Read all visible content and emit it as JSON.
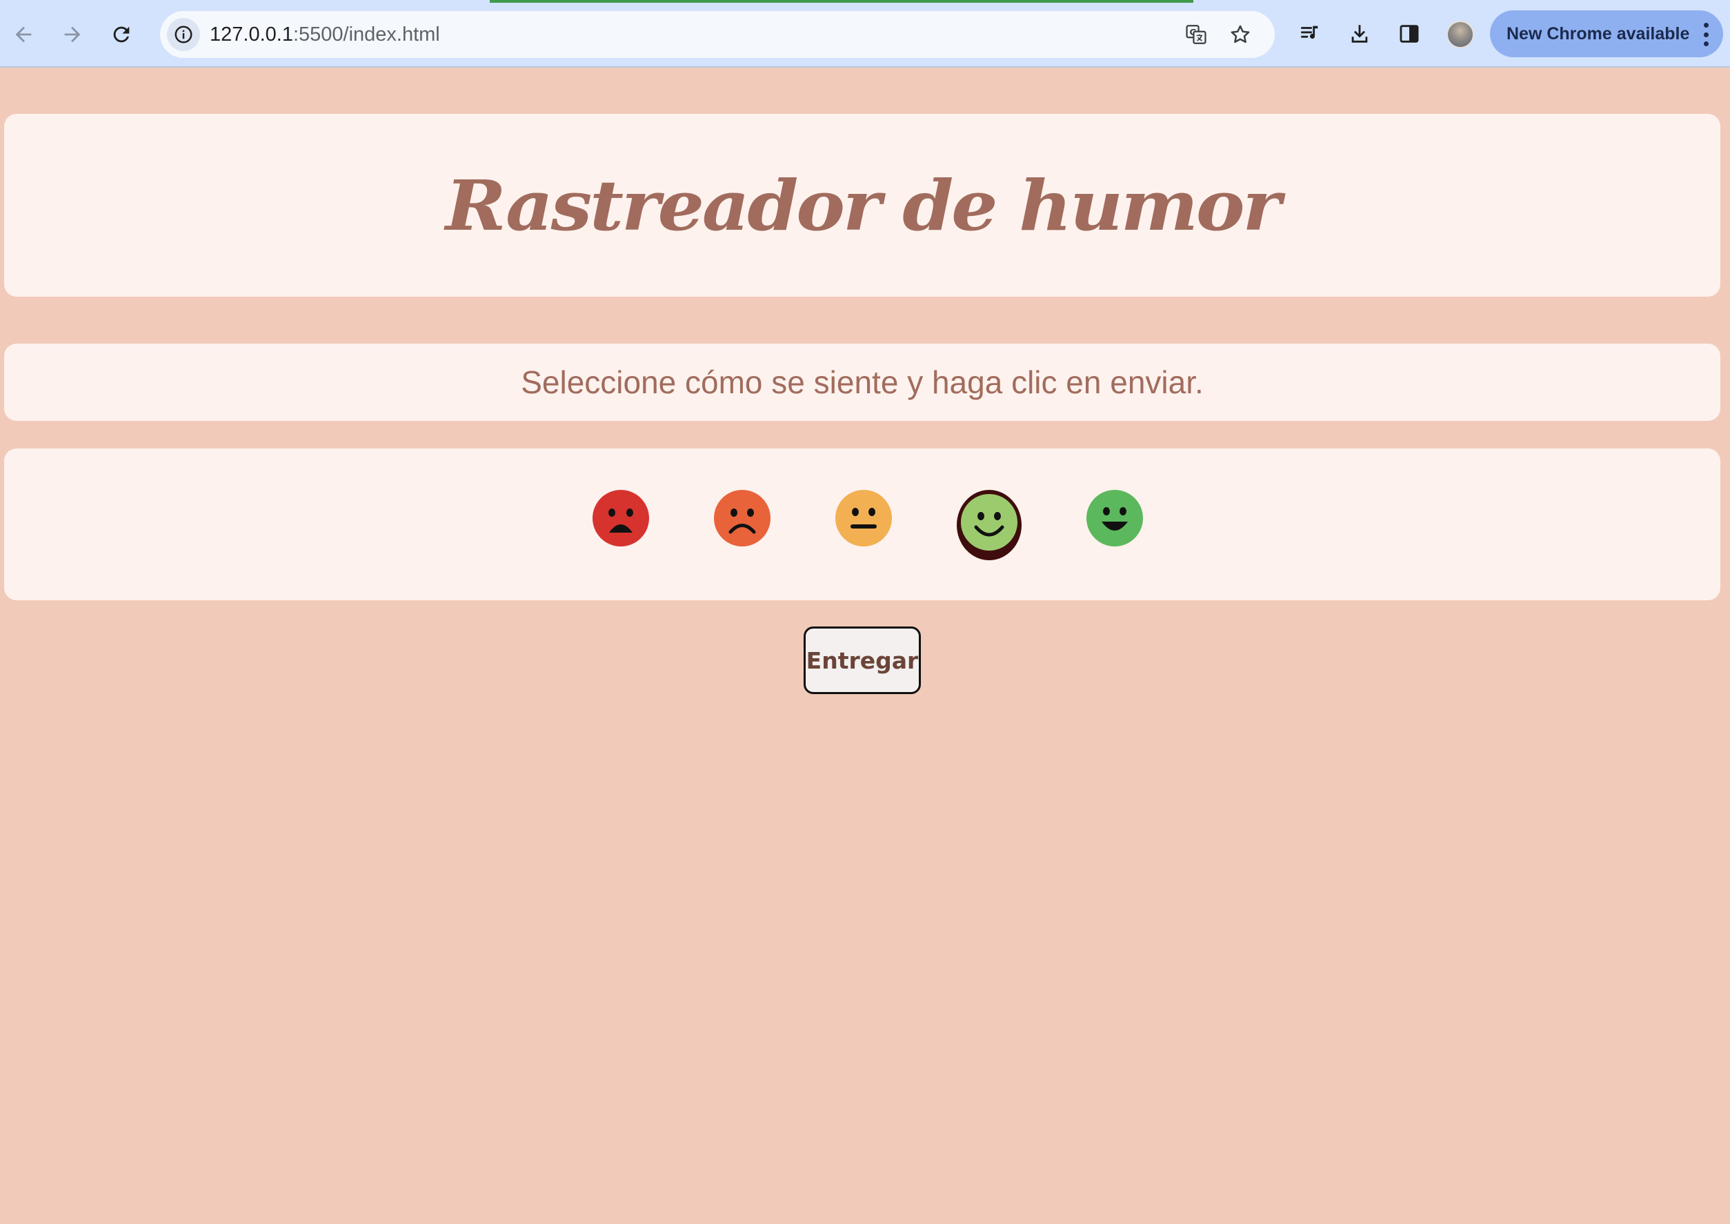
{
  "browser": {
    "url_host": "127.0.0.1",
    "url_rest": ":5500/index.html",
    "update_button_label": "New Chrome available",
    "icons": [
      "back-arrow-icon",
      "forward-arrow-icon",
      "reload-icon",
      "site-info-icon",
      "translate-icon",
      "bookmark-star-icon",
      "media-queue-icon",
      "download-icon",
      "side-panel-icon",
      "profile-avatar",
      "more-menu-icon"
    ]
  },
  "page": {
    "title": "Rastreador de humor",
    "instructions": "Seleccione cómo se siente y haga clic en enviar.",
    "submit_label": "Entregar",
    "colors": {
      "background": "#f2cab9",
      "card": "#fdf2ee",
      "text": "#a16c5d",
      "selected_ring": "#3f0d0d"
    },
    "moods": [
      {
        "name": "very-sad",
        "icon": "crying-face-icon",
        "color": "#d6332e",
        "selected": false
      },
      {
        "name": "sad",
        "icon": "frowning-face-icon",
        "color": "#e8633a",
        "selected": false
      },
      {
        "name": "neutral",
        "icon": "neutral-face-icon",
        "color": "#f2b052",
        "selected": false
      },
      {
        "name": "happy",
        "icon": "smiling-face-icon",
        "color": "#9ccb6e",
        "selected": true
      },
      {
        "name": "very-happy",
        "icon": "grinning-face-icon",
        "color": "#5cb85c",
        "selected": false
      }
    ]
  }
}
